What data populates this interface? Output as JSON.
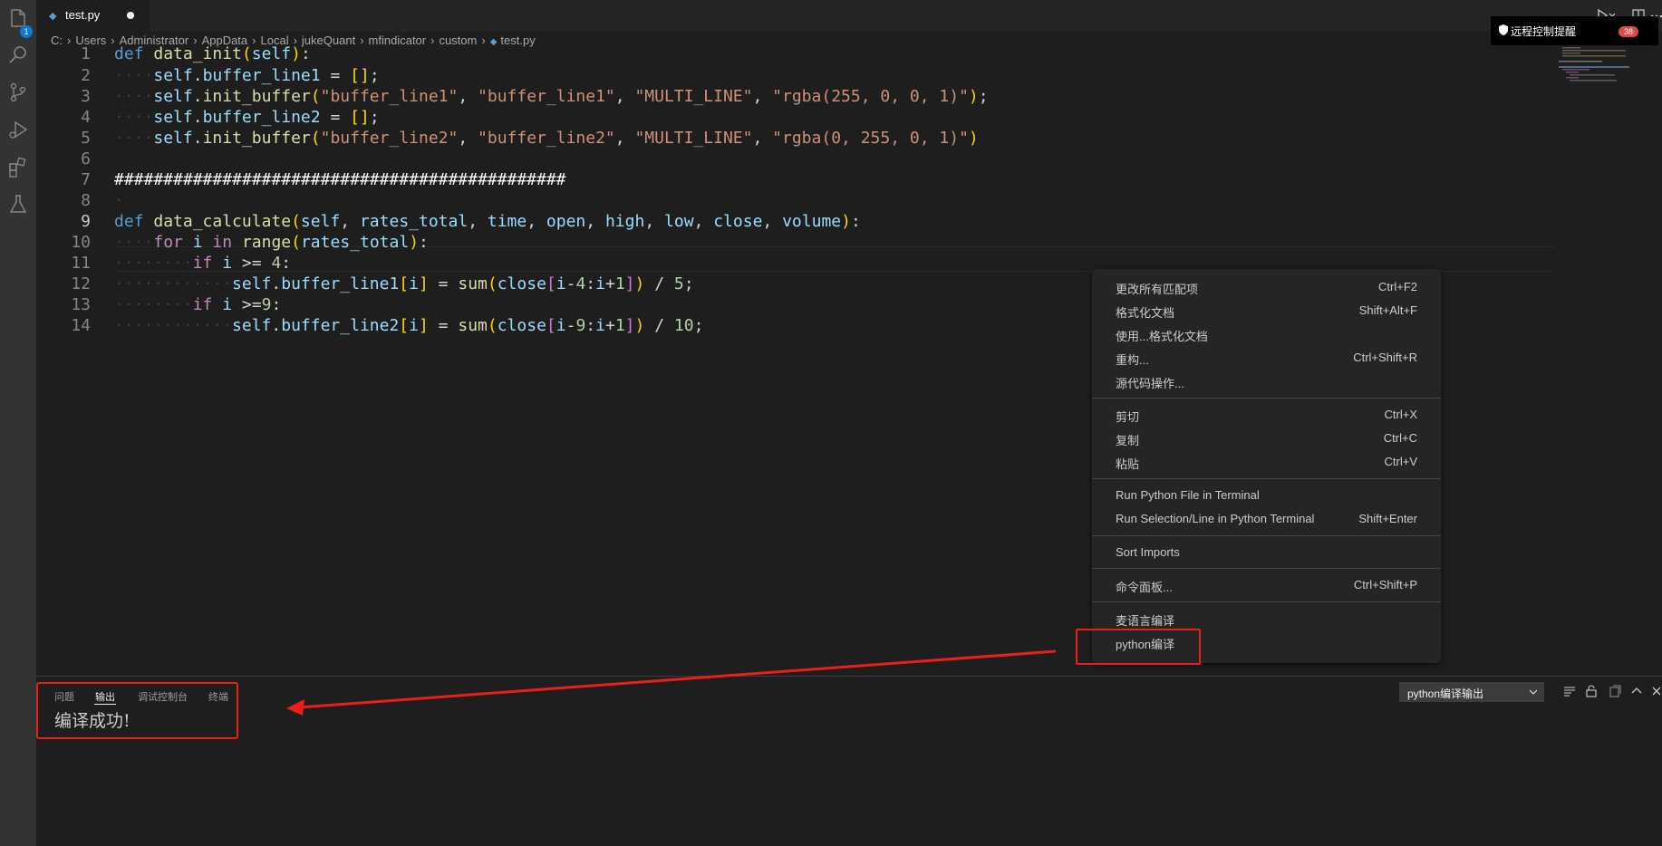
{
  "tab": {
    "filename": "test.py"
  },
  "breadcrumb": [
    "C:",
    "Users",
    "Administrator",
    "AppData",
    "Local",
    "jukeQuant",
    "mfindicator",
    "custom",
    "test.py"
  ],
  "badge_count": "1",
  "editor": {
    "line_numbers": [
      "1",
      "2",
      "3",
      "4",
      "5",
      "6",
      "7",
      "8",
      "9",
      "10",
      "11",
      "12",
      "13",
      "14"
    ],
    "current_line": "9"
  },
  "notification": {
    "title": "远程控制提醒",
    "count": "38"
  },
  "context_menu": {
    "items": [
      {
        "label": "更改所有匹配项",
        "shortcut": "Ctrl+F2"
      },
      {
        "label": "格式化文档",
        "shortcut": "Shift+Alt+F"
      },
      {
        "label": "使用...格式化文档",
        "shortcut": ""
      },
      {
        "label": "重构...",
        "shortcut": "Ctrl+Shift+R"
      },
      {
        "label": "源代码操作...",
        "shortcut": ""
      },
      {
        "label": "剪切",
        "shortcut": "Ctrl+X"
      },
      {
        "label": "复制",
        "shortcut": "Ctrl+C"
      },
      {
        "label": "粘贴",
        "shortcut": "Ctrl+V"
      },
      {
        "label": "Run Python File in Terminal",
        "shortcut": ""
      },
      {
        "label": "Run Selection/Line in Python Terminal",
        "shortcut": "Shift+Enter"
      },
      {
        "label": "Sort Imports",
        "shortcut": ""
      },
      {
        "label": "命令面板...",
        "shortcut": "Ctrl+Shift+P"
      },
      {
        "label": "麦语言编译",
        "shortcut": ""
      },
      {
        "label": "python编译",
        "shortcut": ""
      }
    ]
  },
  "panel": {
    "tabs": [
      "问题",
      "输出",
      "调试控制台",
      "终端"
    ],
    "active_tab": "输出",
    "output_text": "编译成功!",
    "output_channel": "python编译输出"
  },
  "colors": {
    "highlight_red": "#e8201a",
    "badge_blue": "#0e7ad3",
    "count_red": "#e04848"
  }
}
